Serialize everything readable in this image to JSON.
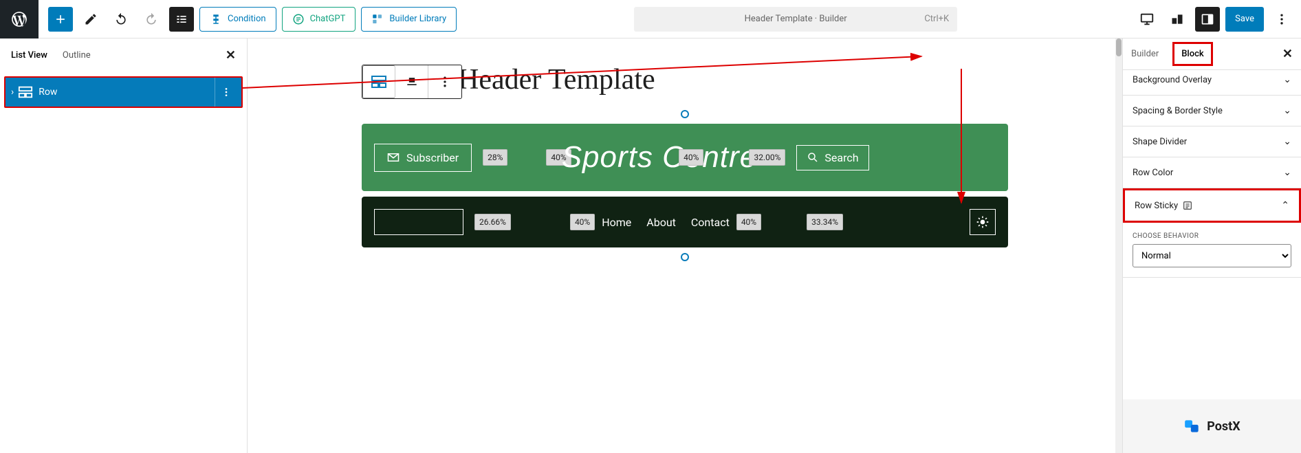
{
  "topbar": {
    "condition": "Condition",
    "chatgpt": "ChatGPT",
    "library": "Builder Library",
    "doc_title": "Header Template · Builder",
    "kbd": "Ctrl+K",
    "save": "Save"
  },
  "left": {
    "tabs": {
      "list": "List View",
      "outline": "Outline"
    },
    "row": "Row"
  },
  "canvas": {
    "title": "Header Template",
    "subscriber": "Subscriber",
    "brand": "Sports Centre",
    "search": "Search",
    "pct": {
      "a": "28%",
      "b": "40%",
      "c": "40%",
      "d": "32.00%",
      "e": "26.66%",
      "f": "40%",
      "g": "40%",
      "h": "33.34%"
    },
    "nav": [
      "Home",
      "About",
      "Contact"
    ]
  },
  "right": {
    "tabs": {
      "builder": "Builder",
      "block": "Block"
    },
    "sections": {
      "bg": "Background Overlay",
      "spacing": "Spacing & Border Style",
      "shape": "Shape Divider",
      "color": "Row Color",
      "sticky": "Row Sticky"
    },
    "behavior_label": "CHOOSE BEHAVIOR",
    "behavior_value": "Normal",
    "brand": "PostX"
  }
}
